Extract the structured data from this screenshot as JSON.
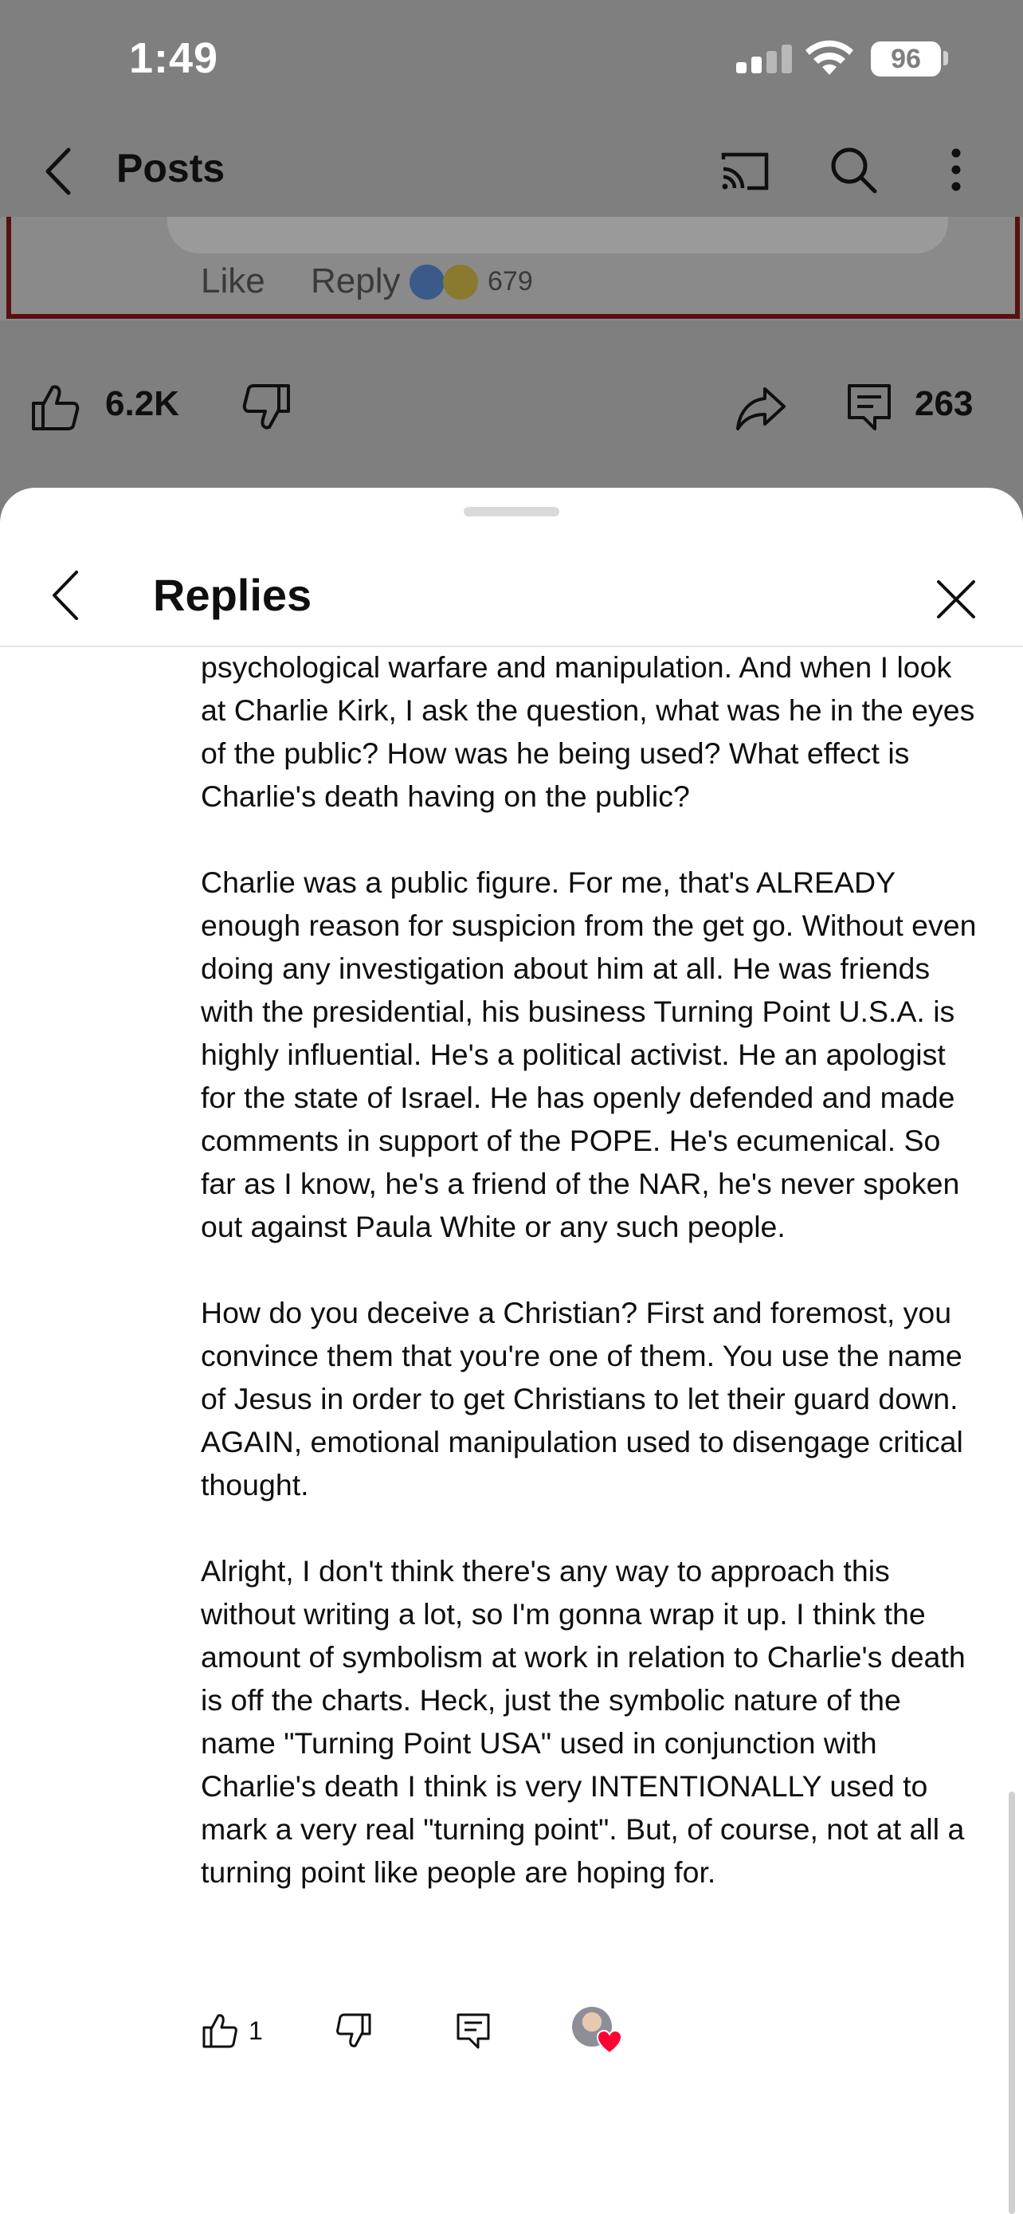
{
  "status_bar": {
    "time": "1:49",
    "battery": "96"
  },
  "top_bar": {
    "title": "Posts"
  },
  "post_image": {
    "like_label": "Like",
    "reply_label": "Reply",
    "reaction_count": "679"
  },
  "post_actions": {
    "like_count": "6.2K",
    "comment_count": "263"
  },
  "sheet": {
    "title": "Replies",
    "paragraphs": [
      "psychological warfare and manipulation. And when I look at Charlie Kirk, I ask the question, what was he in the eyes of the public? How was he being used? What effect is Charlie's death  having on the public?",
      "Charlie was a public figure. For me, that's ALREADY enough reason for suspicion from the get go. Without even doing any investigation about him at all. He was friends with the presidential, his business Turning Point U.S.A. is highly influential. He's a political activist. He an apologist for the state of Israel. He has openly defended and made comments in support of the POPE. He's ecumenical. So far as I know, he's a friend of the NAR, he's never spoken out against Paula White or any such people.",
      "How do you deceive a Christian? First and foremost, you convince them that you're one of them. You use the name of Jesus in order to get Christians to let their guard down. AGAIN, emotional manipulation used to disengage critical thought.",
      "Alright, I don't think there's any way to approach this without writing a lot, so I'm gonna wrap it up. I think the amount of symbolism at work in relation to Charlie's death is off the charts. Heck, just the symbolic nature of the name \"Turning Point USA\" used in conjunction with Charlie's death I think is very INTENTIONALLY used to mark a very real \"turning point\". But, of course, not at all a turning point like people are hoping for."
    ],
    "reply_like_count": "1"
  },
  "colors": {
    "overlay": "#7f7f7f",
    "text": "#0f0f0f",
    "heart": "#ff0033"
  }
}
